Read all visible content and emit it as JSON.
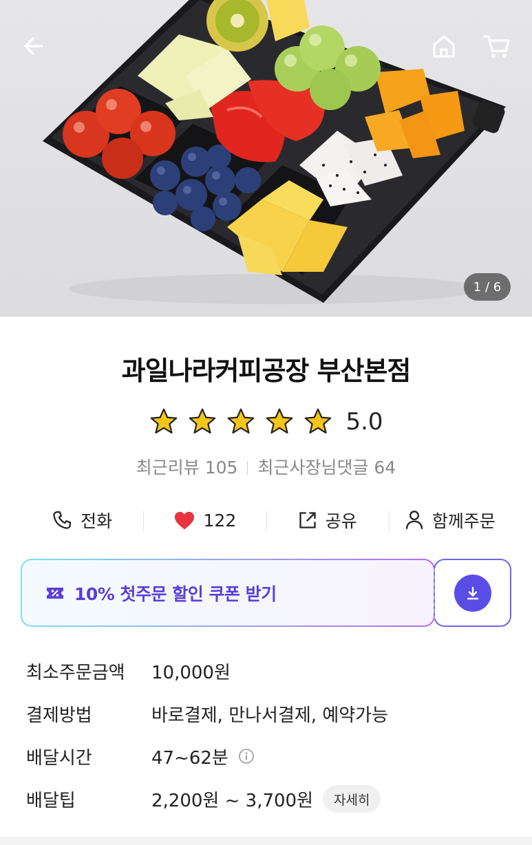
{
  "hero": {
    "image_counter": "1 / 6",
    "back_icon": "arrow-left-icon",
    "home_icon": "home-icon",
    "cart_icon": "cart-icon"
  },
  "store": {
    "name": "과일나라커피공장 부산본점",
    "rating": 5.0,
    "rating_text": "5.0",
    "stars": 5,
    "recent_reviews_label": "최근리뷰 105",
    "owner_replies_label": "최근사장님댓글 64"
  },
  "actions": {
    "call_label": "전화",
    "like_count": "122",
    "share_label": "공유",
    "group_order_label": "함께주문"
  },
  "coupon": {
    "text": "10% 첫주문 할인 쿠폰 받기"
  },
  "info": {
    "min_order_label": "최소주문금액",
    "min_order_value": "10,000원",
    "payment_label": "결제방법",
    "payment_value": "바로결제, 만나서결제, 예약가능",
    "delivery_time_label": "배달시간",
    "delivery_time_value": "47~62분",
    "delivery_tip_label": "배달팁",
    "delivery_tip_value": "2,200원 ~ 3,700원",
    "detail_button": "자세히"
  },
  "colors": {
    "accent": "#5a4de6",
    "star": "#f5c518",
    "heart": "#e8343f"
  }
}
